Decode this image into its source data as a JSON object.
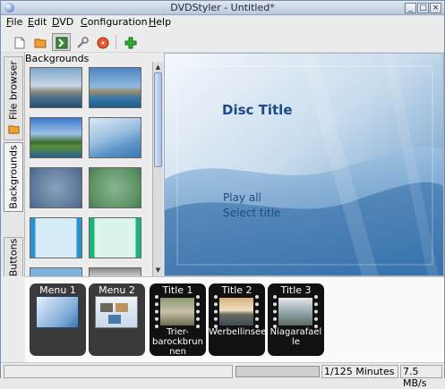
{
  "window": {
    "title": "DVDStyler - Untitled*",
    "controls": [
      "_",
      "□",
      "×"
    ]
  },
  "menubar": [
    {
      "label": "File",
      "key": "F",
      "rest": "ile"
    },
    {
      "label": "Edit",
      "key": "E",
      "rest": "dit"
    },
    {
      "label": "DVD",
      "key": "D",
      "rest": "VD"
    },
    {
      "label": "Configuration",
      "key": "C",
      "rest": "onfiguration"
    },
    {
      "label": "Help",
      "key": "H",
      "rest": "elp"
    }
  ],
  "toolbar": {
    "icons": [
      "new-file-icon",
      "open-folder-icon",
      "save-icon",
      "settings-wrench-icon",
      "burn-disc-icon",
      "add-icon"
    ]
  },
  "side_tabs": [
    {
      "label": "File browser",
      "icon": "folder-icon"
    },
    {
      "label": "Backgrounds",
      "active": true
    },
    {
      "label": "Buttons"
    }
  ],
  "backgrounds_panel": {
    "title": "Backgrounds"
  },
  "preview": {
    "disc_title": "Disc Title",
    "menu_items": [
      "Play all",
      "Select title"
    ]
  },
  "titleset": [
    {
      "label": "Menu 1",
      "kind": "menu"
    },
    {
      "label": "Menu 2",
      "kind": "menu"
    },
    {
      "label": "Title 1",
      "kind": "title",
      "name": "Trier-barockbrunnen",
      "name_lines": [
        "Trier-",
        "barockbrun",
        "nen"
      ]
    },
    {
      "label": "Title 2",
      "kind": "title",
      "name": "Werbellinsee",
      "name_lines": [
        "Werbellinsee"
      ]
    },
    {
      "label": "Title 3",
      "kind": "title",
      "name": "Niagarafaelle",
      "name_lines": [
        "Niagarafael",
        "le"
      ]
    }
  ],
  "status": {
    "duration": "1/125 Minutes",
    "rate": "7.5 MB/s"
  }
}
